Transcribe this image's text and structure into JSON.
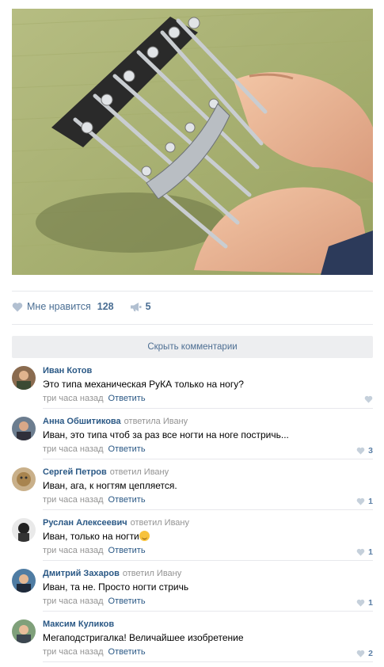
{
  "post": {
    "image_name": "mechanical-pedicure-device-photo"
  },
  "actions": {
    "like_label": "Мне нравится",
    "like_count": "128",
    "share_count": "5"
  },
  "comments_toggle": "Скрыть комментарии",
  "comments": [
    {
      "author": "Иван Котов",
      "replied": "",
      "text": "Это типа механическая РуКА только на ногу?",
      "time": "три часа назад",
      "reply": "Ответить",
      "likes": ""
    },
    {
      "author": "Анна Обшитикова",
      "replied": "ответила Ивану",
      "text": "Иван, это типа чтоб за раз все ногти на ноге постричь...",
      "time": "три часа назад",
      "reply": "Ответить",
      "likes": "3"
    },
    {
      "author": "Сергей Петров",
      "replied": "ответил Ивану",
      "text": "Иван, ага, к ногтям цепляется.",
      "time": "три часа назад",
      "reply": "Ответить",
      "likes": "1"
    },
    {
      "author": "Руслан Алексеевич",
      "replied": "ответил Ивану",
      "text": "Иван, только на ногти",
      "time": "три часа назад",
      "reply": "Ответить",
      "likes": "1"
    },
    {
      "author": "Дмитрий Захаров",
      "replied": "ответил Ивану",
      "text": "Иван, та не. Просто ногти стричь",
      "time": "три часа назад",
      "reply": "Ответить",
      "likes": "1"
    },
    {
      "author": "Максим Куликов",
      "replied": "",
      "text": "Мегаподстригалка! Величайшее изобретение",
      "time": "три часа назад",
      "reply": "Ответить",
      "likes": "2"
    }
  ],
  "colors": {
    "link": "#2a5885",
    "muted": "#939393",
    "action": "#4a6e93",
    "separator": "#e7e8ec"
  }
}
